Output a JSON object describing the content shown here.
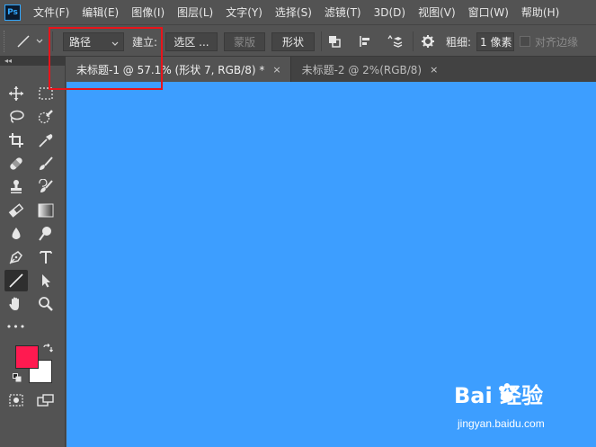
{
  "app": {
    "logo_text": "Ps"
  },
  "menu": [
    "文件(F)",
    "编辑(E)",
    "图像(I)",
    "图层(L)",
    "文字(Y)",
    "选择(S)",
    "滤镜(T)",
    "3D(D)",
    "视图(V)",
    "窗口(W)",
    "帮助(H)"
  ],
  "options": {
    "mode_value": "路径",
    "create_label": "建立:",
    "selection_button": "选区 ...",
    "mask_button": "蒙版",
    "shape_button": "形状",
    "weight_label": "粗细:",
    "weight_value": "1 像素",
    "align_edges_label": "对齐边缘"
  },
  "tabs": [
    {
      "title": "未标题-1 @ 57.1% (形状 7, RGB/8) *",
      "close": "×"
    },
    {
      "title": "未标题-2 @ 2%(RGB/8)",
      "close": "×"
    }
  ],
  "toolbar": {
    "more_label": "•••",
    "foreground_color": "#ff1a50",
    "background_color": "#ffffff"
  },
  "canvas": {
    "color": "#3d9eff"
  },
  "watermark": {
    "logo": "Bai 经验",
    "sub": "jingyan.baidu.com"
  },
  "colors": {
    "highlight_box": "#e8141b",
    "ui_bg": "#535353"
  }
}
